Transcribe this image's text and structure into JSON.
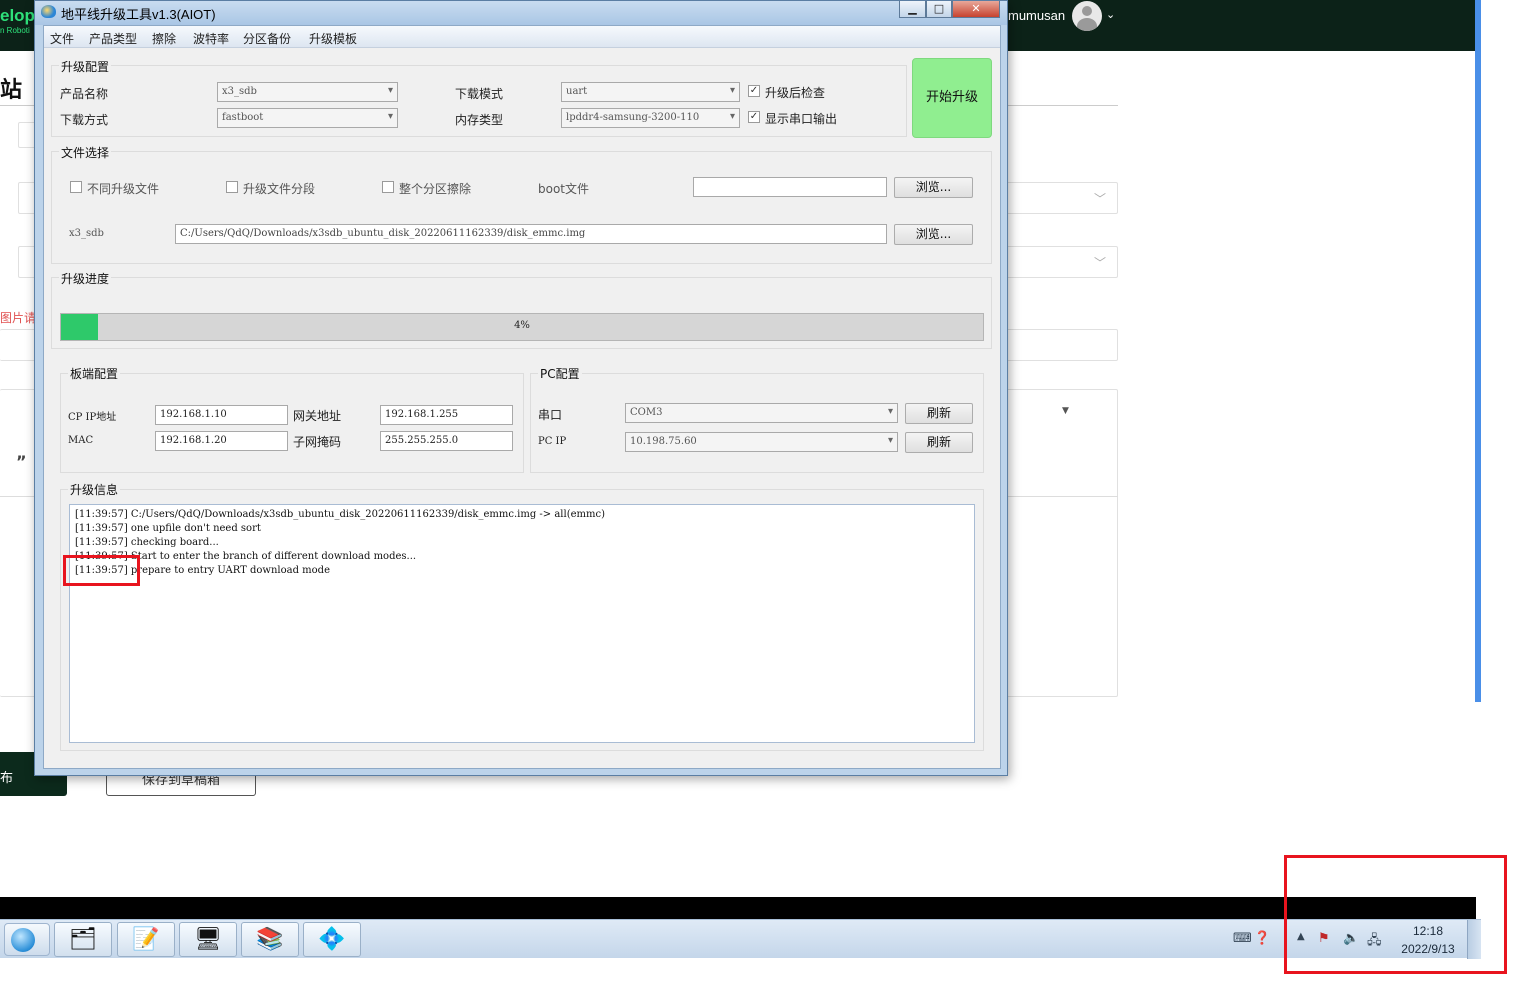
{
  "background_page": {
    "logo_text": "elop",
    "logo_sub": "n Roboti",
    "username": "mumusan",
    "page_title_fragment": "站",
    "red_hint_fragment": "图片请",
    "publish_fragment": "布",
    "save_draft_fragment": "保存到草稿箱",
    "quote_mark": "”"
  },
  "window": {
    "title": "地平线升级工具v1.3(AIOT)",
    "controls": {
      "minimize": "▁",
      "maximize": "□",
      "close": "✕"
    }
  },
  "menu": [
    "文件",
    "产品类型",
    "擦除",
    "波特率",
    "分区备份",
    "升级模板"
  ],
  "upgrade_config": {
    "title": "升级配置",
    "product_label": "产品名称",
    "product_value": "x3_sdb",
    "download_method_label": "下载方式",
    "download_method_value": "fastboot",
    "download_mode_label": "下载模式",
    "download_mode_value": "uart",
    "memory_label": "内存类型",
    "memory_value": "lpddr4-samsung-3200-110",
    "check_after_label": "升级后检查",
    "check_after_checked": true,
    "show_serial_label": "显示串口输出",
    "show_serial_checked": true,
    "start_button": "开始升级"
  },
  "file_select": {
    "title": "文件选择",
    "opt_different": "不同升级文件",
    "opt_split": "升级文件分段",
    "opt_erase_all": "整个分区擦除",
    "boot_label": "boot文件",
    "boot_value": "",
    "browse": "浏览...",
    "image_label": "x3_sdb",
    "image_path": "C:/Users/QdQ/Downloads/x3sdb_ubuntu_disk_20220611162339/disk_emmc.img"
  },
  "progress": {
    "title": "升级进度",
    "percent": 4,
    "text": "4%"
  },
  "board_config": {
    "title": "板端配置",
    "cp_ip_label": "CP IP地址",
    "cp_ip_value": "192.168.1.10",
    "gateway_label": "网关地址",
    "gateway_value": "192.168.1.255",
    "mac_label": "MAC",
    "mac_value": "192.168.1.20",
    "netmask_label": "子网掩码",
    "netmask_value": "255.255.255.0"
  },
  "pc_config": {
    "title": "PC配置",
    "serial_label": "串口",
    "serial_value": "COM3",
    "pc_ip_label": "PC IP",
    "pc_ip_value": "10.198.75.60",
    "refresh": "刷新"
  },
  "upgrade_info": {
    "title": "升级信息",
    "lines": [
      "[11:39:57] C:/Users/QdQ/Downloads/x3sdb_ubuntu_disk_20220611162339/disk_emmc.img -> all(emmc)",
      "[11:39:57] one upfile don't need sort",
      "[11:39:57] checking board...",
      "[11:39:57] Start to enter the branch of different download modes...",
      "[11:39:57] prepare to entry UART download mode"
    ]
  },
  "taskbar": {
    "time": "12:18",
    "date": "2022/9/13",
    "apps": [
      "start-orb",
      "file-explorer",
      "notepad",
      "network-computer",
      "winrar",
      "upgrade-tool"
    ]
  },
  "colors": {
    "start_button_bg": "#90ee90",
    "progress_fill": "#2ec96a",
    "annotation_red": "#e8141e",
    "topbar_bg": "#0c2218"
  }
}
